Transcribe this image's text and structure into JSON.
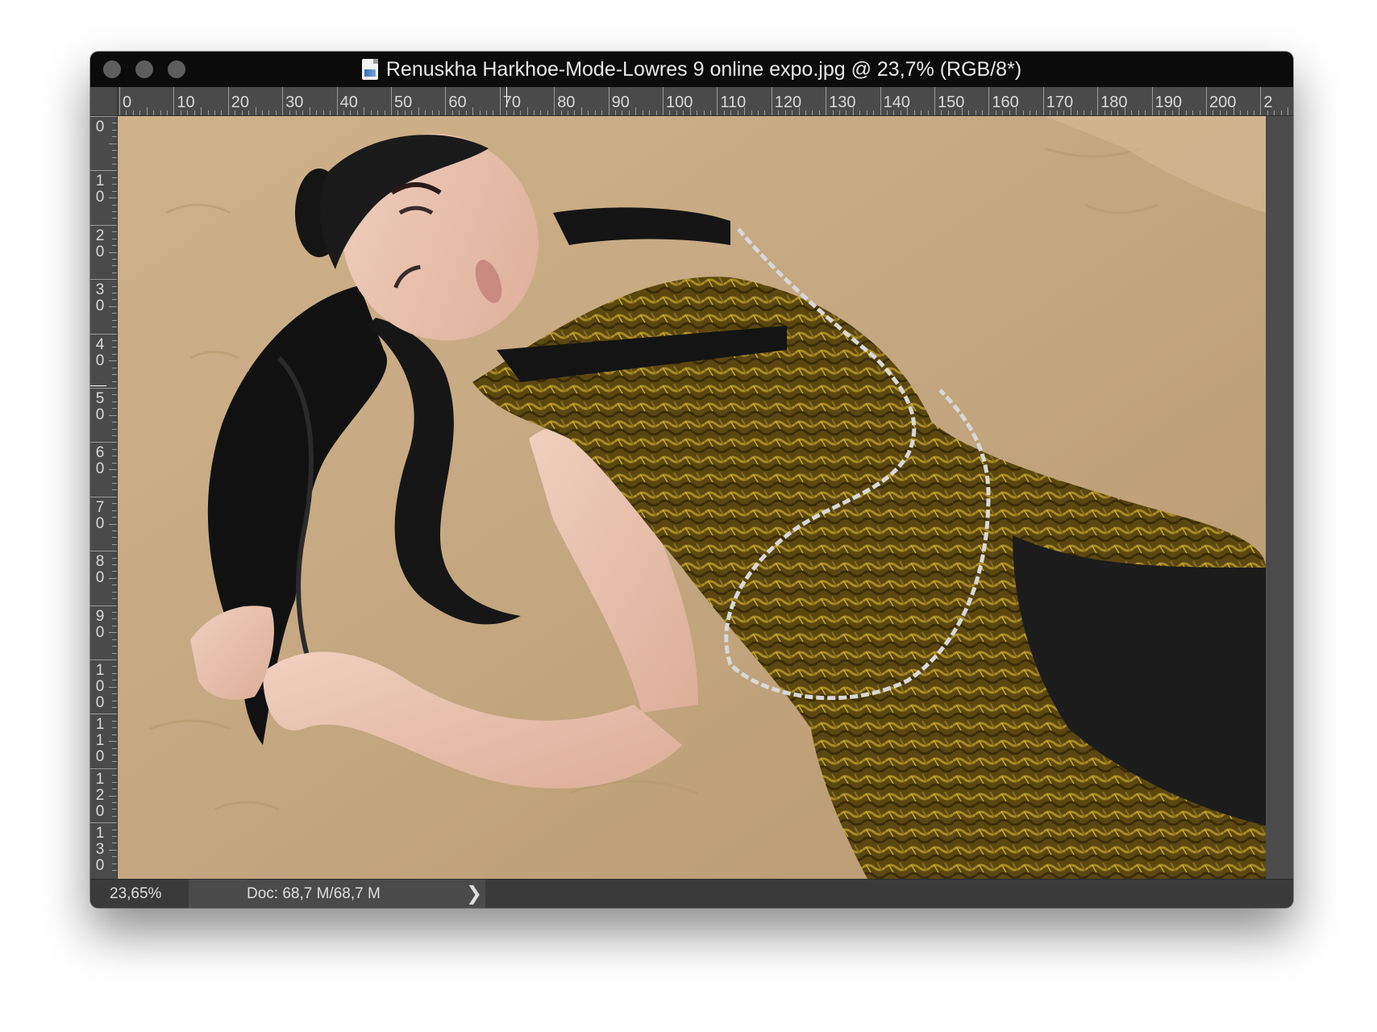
{
  "window": {
    "title": "Renuskha Harkhoe-Mode-Lowres 9 online expo.jpg @ 23,7% (RGB/8*)",
    "file_icon": "jpg-document-icon"
  },
  "rulers": {
    "horizontal_labels": [
      "0",
      "10",
      "20",
      "30",
      "40",
      "50",
      "60",
      "70",
      "80",
      "90",
      "100",
      "110",
      "120",
      "130",
      "140",
      "150",
      "160",
      "170",
      "180",
      "190",
      "200",
      "2"
    ],
    "vertical_labels": [
      "0",
      "1\n0",
      "2\n0",
      "3\n0",
      "4\n0",
      "5\n0",
      "6\n0",
      "7\n0",
      "8\n0",
      "9\n0",
      "1\n0\n0",
      "1\n1\n0",
      "1\n2\n0",
      "1\n3\n0"
    ]
  },
  "status": {
    "zoom": "23,65%",
    "doc_size": "Doc: 68,7 M/68,7 M",
    "arrow": "❯"
  },
  "colors": {
    "titlebar": "#0b0b0b",
    "chrome": "#3a3a3a",
    "ruler": "#4a4a4a",
    "sand": "#c6a983",
    "dress_gold": "#6b5514"
  }
}
